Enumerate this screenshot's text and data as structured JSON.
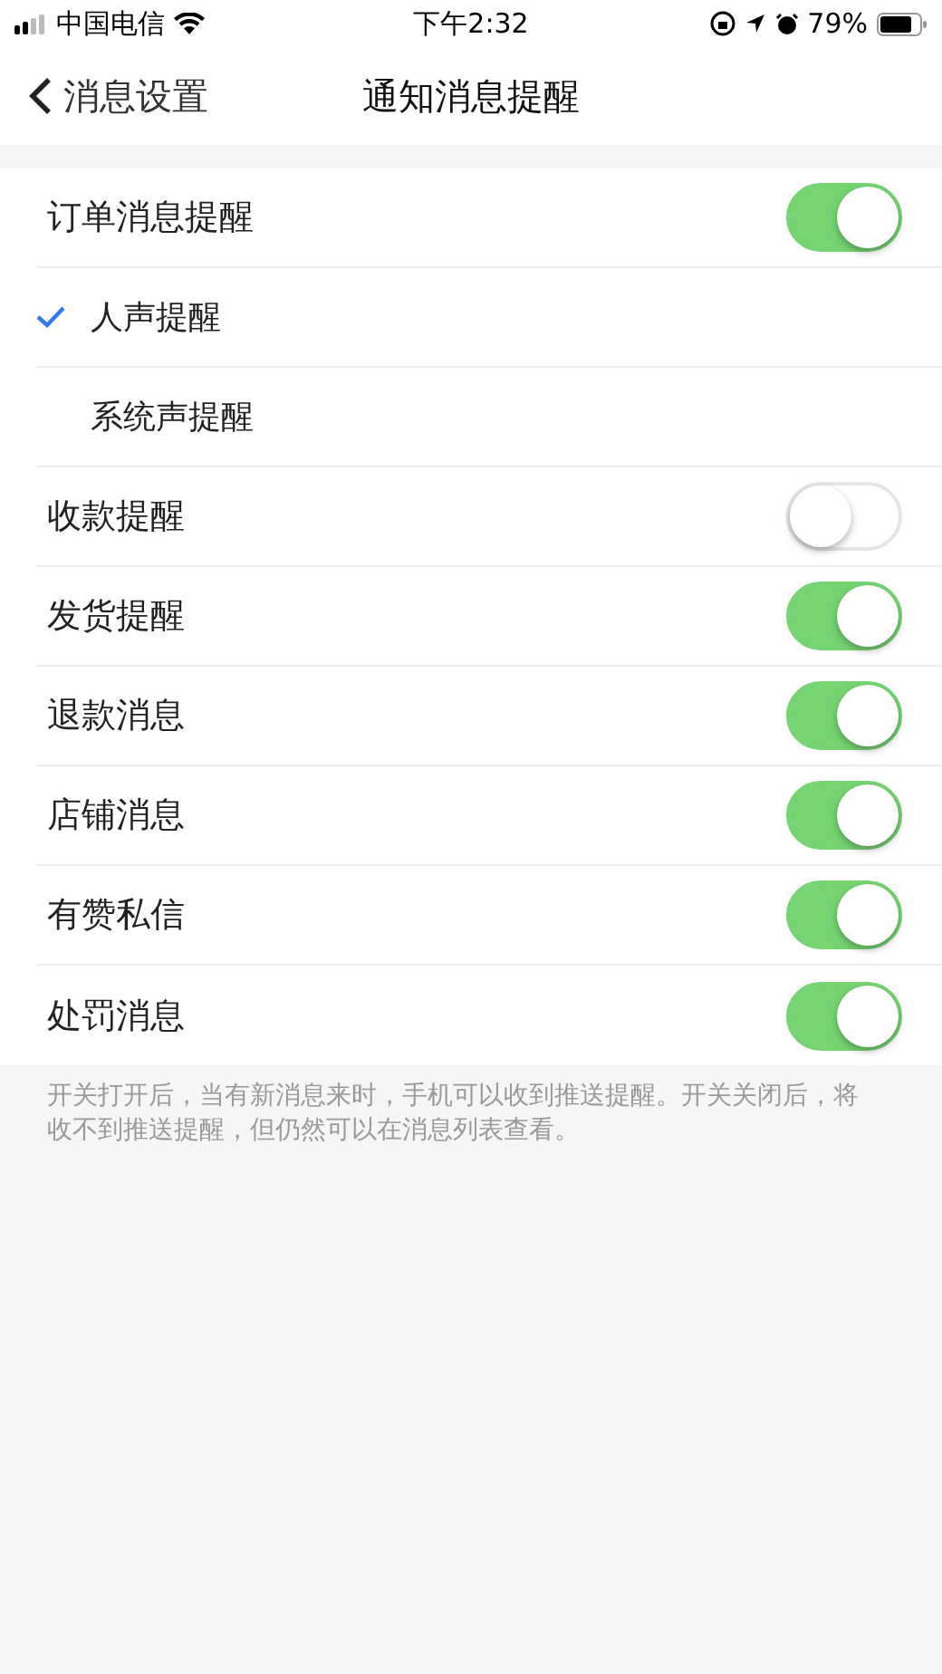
{
  "status_bar": {
    "carrier": "中国电信",
    "time": "下午2:32",
    "battery": "79%"
  },
  "nav": {
    "back": "消息设置",
    "title": "通知消息提醒"
  },
  "rows": [
    {
      "kind": "toggle",
      "label": "订单消息提醒",
      "on": true
    },
    {
      "kind": "option",
      "label": "人声提醒",
      "selected": true
    },
    {
      "kind": "option",
      "label": "系统声提醒",
      "selected": false
    },
    {
      "kind": "toggle",
      "label": "收款提醒",
      "on": false
    },
    {
      "kind": "toggle",
      "label": "发货提醒",
      "on": true
    },
    {
      "kind": "toggle",
      "label": "退款消息",
      "on": true
    },
    {
      "kind": "toggle",
      "label": "店铺消息",
      "on": true
    },
    {
      "kind": "toggle",
      "label": "有赞私信",
      "on": true
    },
    {
      "kind": "toggle",
      "label": "处罚消息",
      "on": true
    }
  ],
  "footnote": "开关打开后，当有新消息来时，手机可以收到推送提醒。开关关闭后，将收不到推送提醒，但仍然可以在消息列表查看。"
}
